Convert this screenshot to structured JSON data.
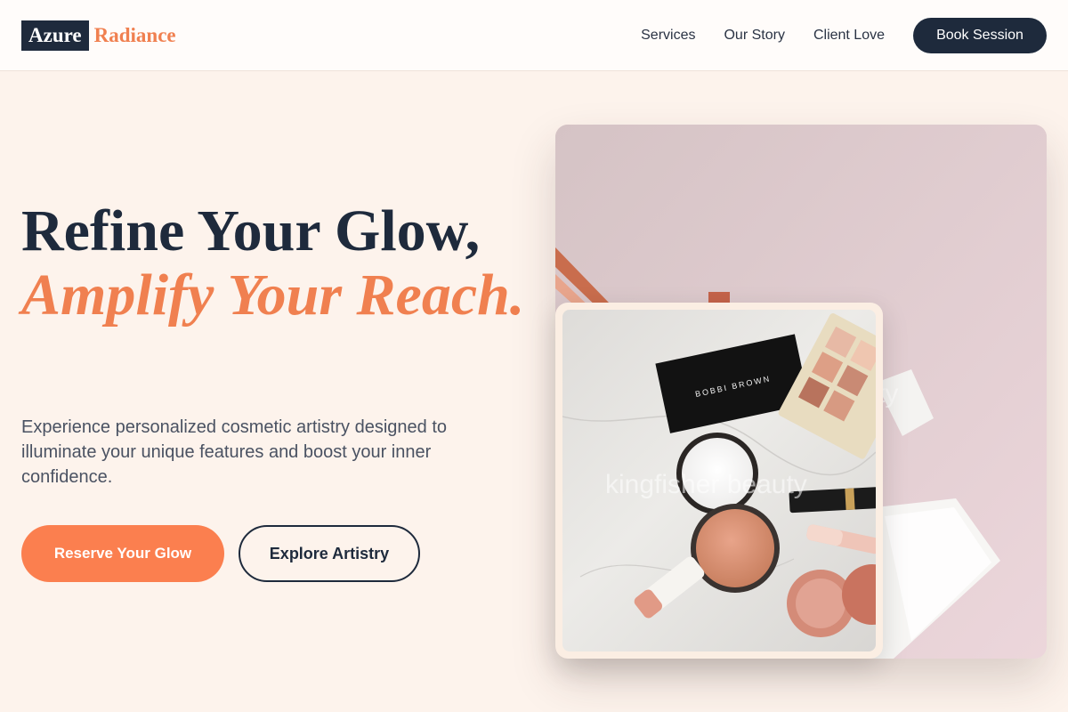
{
  "brand": {
    "name": "Azure",
    "accent": "Radiance"
  },
  "nav": {
    "links": [
      "Services",
      "Our Story",
      "Client Love"
    ],
    "cta": "Book Session"
  },
  "hero": {
    "headline": "Refine Your Glow,",
    "headline_accent": "Amplify Your Reach.",
    "description": "Experience personalized cosmetic artistry designed to illuminate your unique features and boost your inner confidence.",
    "primary_cta": "Reserve Your Glow",
    "secondary_cta": "Explore Artistry"
  },
  "images": {
    "compact_brand": "BOBBI BROWN",
    "watermark": "kingfisher beauty",
    "watermark_back": "ty"
  },
  "colors": {
    "navy": "#1e2a3c",
    "coral": "#fb7f4f",
    "background": "#fdf3ec"
  }
}
